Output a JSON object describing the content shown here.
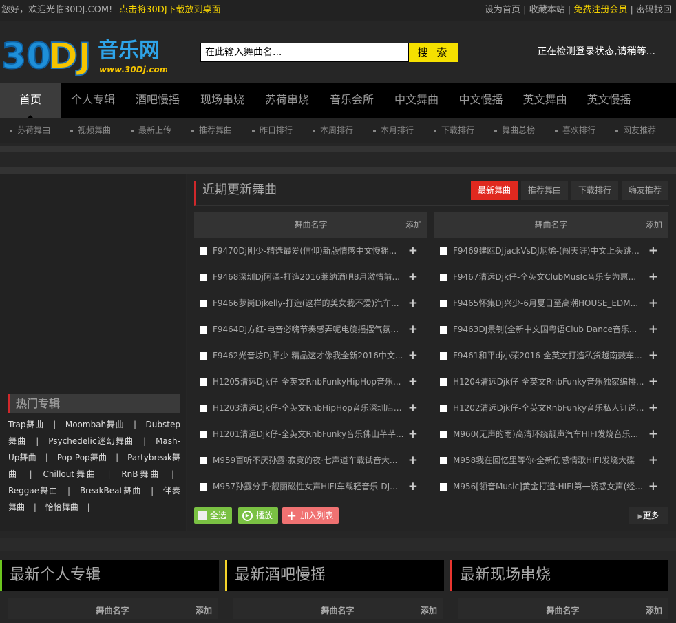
{
  "topbar": {
    "welcome": "您好，欢迎光临30DJ.COM!",
    "desktop_link": "点击将30DJ下载放到桌面",
    "links": [
      "设为首页",
      "收藏本站",
      "免费注册会员",
      "密码找回"
    ]
  },
  "logo": {
    "text": "30DJ音乐网",
    "url_text": "www.30Dj.com"
  },
  "search": {
    "placeholder": "在此输入舞曲名...",
    "button": "搜 索"
  },
  "login_status": "正在检测登录状态,请稍等...",
  "nav": [
    "首页",
    "个人专辑",
    "酒吧慢摇",
    "现场串烧",
    "苏荷串烧",
    "音乐会所",
    "中文舞曲",
    "中文慢摇",
    "英文舞曲",
    "英文慢摇"
  ],
  "subnav": [
    "苏荷舞曲",
    "视频舞曲",
    "最新上传",
    "推荐舞曲",
    "昨日排行",
    "本周排行",
    "本月排行",
    "下载排行",
    "舞曲总榜",
    "喜欢排行",
    "网友推荐"
  ],
  "sidebar": {
    "title": "热门专辑",
    "tags": [
      "Trap舞曲",
      "Moombah舞曲",
      "Dubstep舞曲",
      "Psychedelic迷幻舞曲",
      "Mash-Up舞曲",
      "Pop-Pop舞曲",
      "Partybreak舞曲",
      "Chillout舞曲",
      "RnB舞曲",
      "Reggae舞曲",
      "BreakBeat舞曲",
      "伴奏舞曲",
      "恰恰舞曲"
    ]
  },
  "main": {
    "title": "近期更新舞曲",
    "tabs": [
      "最新舞曲",
      "推荐舞曲",
      "下载排行",
      "嗨友推荐"
    ],
    "col_header": "舞曲名字",
    "col_add": "添加",
    "left_songs": [
      "F9470Dj刚少-精选最爱(信仰)新版情感中文慢摇...",
      "F9468深圳Dj阿泽-打造2016莱纳酒吧8月激情前...",
      "F9466萝岗Djkelly-打造(这样的美女我不爱)汽车...",
      "F9464DJ方红-电音必嗨节奏感弄呢电旋摇摆气氛...",
      "F9462光音坊Dj阳少-精品这才像我全新2016中文...",
      "H1205清远Djk仔-全英文RnbFunkyHipHop音乐...",
      "H1203清远Djk仔-全英文RnbHipHop音乐深圳店...",
      "H1201清远Djk仔-全英文RnbFunky音乐佛山芊芊...",
      "M959百听不厌孙露·寂寞的夜·七声道车载试音大...",
      "M957孙露分手·靓丽磁性女声HIFI车载轻音乐-DJ..."
    ],
    "right_songs": [
      "F9469建瓯DJjackVsDJ炳烯-(闯天涯)中文上头跳...",
      "F9467清远Djk仔-全英文ClubMusIc音乐专为惠...",
      "F9465怀集Dj兴少-6月夏日至高潮HOUSE_EDM...",
      "F9463DJ景钊(全新中文国粤语Club Dance音乐...",
      "F9461和平dj小荣2016-全英文打造私货越南鼓车...",
      "H1204清远Djk仔-全英文RnbFunky音乐独家编排...",
      "H1202清远Djk仔-全英文RnbFunky音乐私人订送...",
      "M960(无声的雨)高清环绕靓声汽车HIFI发烧音乐...",
      "M958我在回忆里等你·全新伤感情歌HIFI发烧大碟",
      "M956[领音Music]黄金打造·HIFI第一诱惑女声(经..."
    ],
    "buttons": {
      "select_all": "全选",
      "play": "播放",
      "add_list": "加入列表",
      "more": "更多"
    }
  },
  "bottom_sections": [
    {
      "title": "最新个人专辑",
      "color": "#6cc51e"
    },
    {
      "title": "最新酒吧慢摇",
      "color": "#f5d32a"
    },
    {
      "title": "最新现场串烧",
      "color": "#e8352f"
    }
  ],
  "colors": {
    "accent_red": "#e0291f",
    "yellow": "#f5e000",
    "green": "#7ac143",
    "pink": "#f07272"
  }
}
